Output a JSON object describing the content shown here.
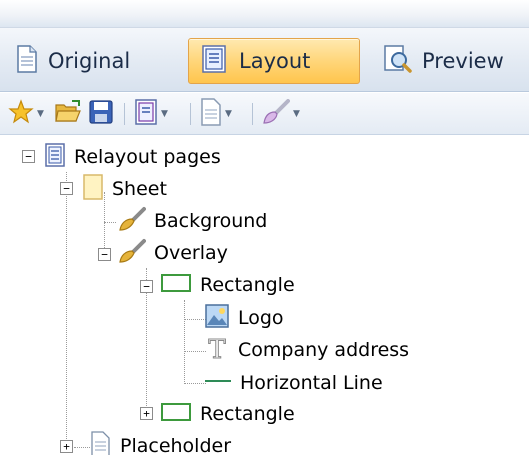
{
  "view_tabs": [
    {
      "label": "Original",
      "icon": "document-icon",
      "active": false
    },
    {
      "label": "Layout",
      "icon": "layout-icon",
      "active": true
    },
    {
      "label": "Preview",
      "icon": "preview-icon",
      "active": false
    }
  ],
  "toolbar": {
    "items": [
      "star-icon",
      "open-folder-icon",
      "save-icon",
      "page-layout-icon",
      "page-icon",
      "brush-icon"
    ]
  },
  "tree": {
    "root": "Relayout pages",
    "sheet": "Sheet",
    "background": "Background",
    "overlay": "Overlay",
    "rectangle_1": "Rectangle",
    "logo": "Logo",
    "company_address": "Company address",
    "horizontal_line": "Horizontal Line",
    "rectangle_2": "Rectangle",
    "placeholder": "Placeholder"
  },
  "colors": {
    "active_tab": "#ffd67a",
    "rectangle_icon": "#3d9a3d",
    "line_icon": "#2e8b57"
  }
}
